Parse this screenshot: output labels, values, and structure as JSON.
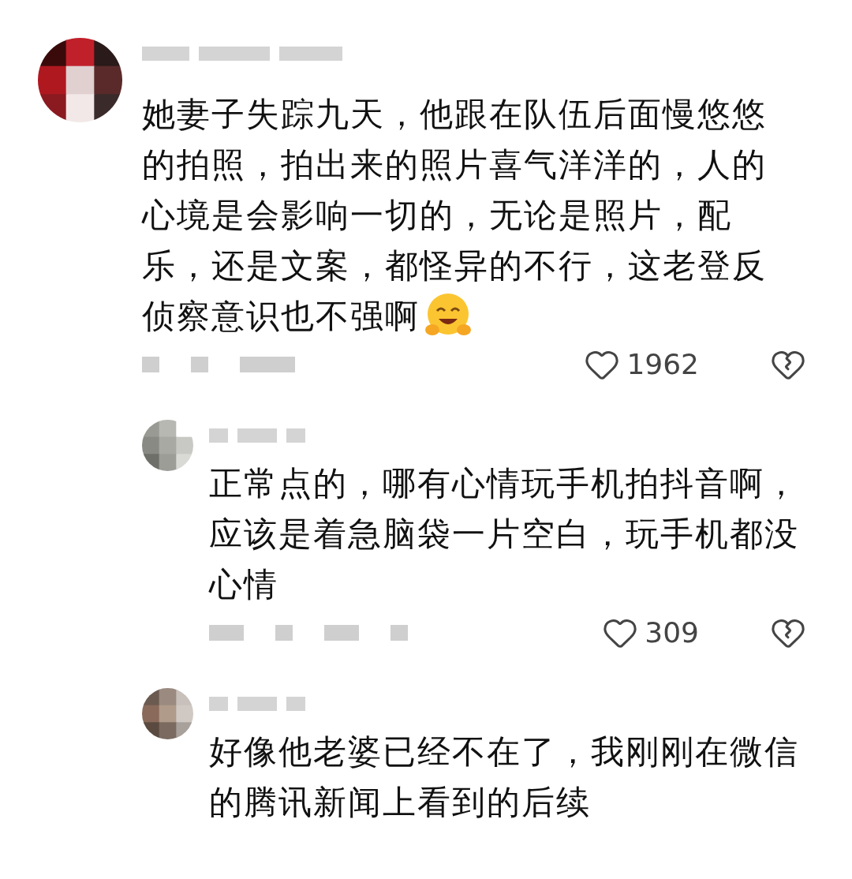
{
  "comments": [
    {
      "lines": [
        "她妻子失踪九天，他跟在队伍后面慢悠悠",
        "的拍照，拍出来的照片喜气洋洋的，人的",
        "心境是会影响一切的，无论是照片，配",
        "乐，还是文案，都怪异的不行，这老登反",
        "侦察意识也不强啊"
      ],
      "trailing_emoji": true,
      "likes": "1962",
      "replies": [
        {
          "lines": [
            "正常点的，哪有心情玩手机拍抖音啊，",
            "应该是着急脑袋一片空白，玩手机都没",
            "心情"
          ],
          "likes": "309"
        },
        {
          "lines": [
            "好像他老婆已经不在了，我刚刚在微信",
            "的腾讯新闻上看到的后续"
          ]
        }
      ]
    }
  ]
}
